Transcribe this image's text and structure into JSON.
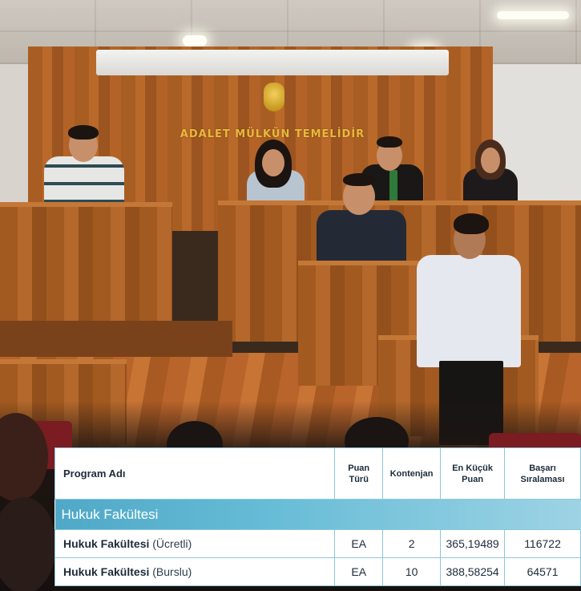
{
  "photo": {
    "motto": "ADALET MÜLKÜN TEMELİDİR"
  },
  "table": {
    "headers": {
      "program": "Program Adı",
      "type_line1": "Puan",
      "type_line2": "Türü",
      "quota": "Kontenjan",
      "min_line1": "En Küçük",
      "min_line2": "Puan",
      "rank_line1": "Başarı",
      "rank_line2": "Sıralaması"
    },
    "section": "Hukuk Fakültesi",
    "rows": [
      {
        "name": "Hukuk Fakültesi",
        "variant": "(Ücretli)",
        "type": "EA",
        "quota": "2",
        "min_score": "365,19489",
        "rank": "116722"
      },
      {
        "name": "Hukuk Fakültesi",
        "variant": "(Burslu)",
        "type": "EA",
        "quota": "10",
        "min_score": "388,58254",
        "rank": "64571"
      }
    ]
  }
}
